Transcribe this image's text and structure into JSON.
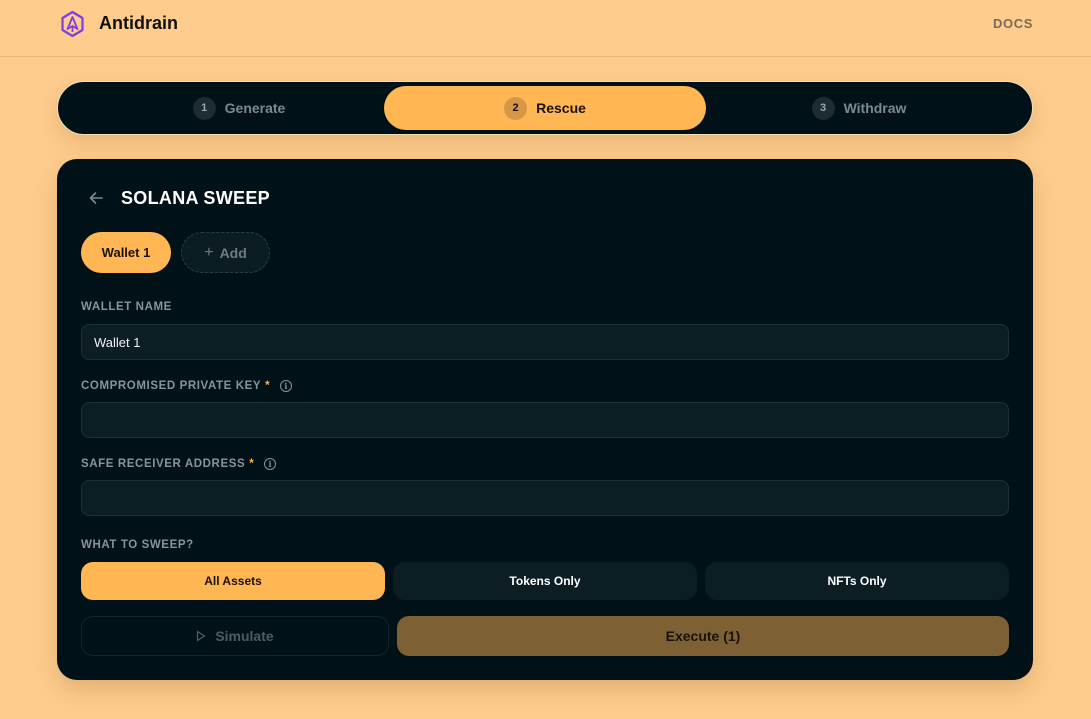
{
  "header": {
    "logo_icon": "antidrain-logo-icon",
    "brand": "Antidrain",
    "docs_link": "DOCS"
  },
  "stepper": {
    "steps": [
      {
        "number": "1",
        "label": "Generate",
        "active": false
      },
      {
        "number": "2",
        "label": "Rescue",
        "active": true
      },
      {
        "number": "3",
        "label": "Withdraw",
        "active": false
      }
    ]
  },
  "panel": {
    "back_icon": "arrow-left-icon",
    "title": "SOLANA SWEEP",
    "wallet_tabs": [
      {
        "label": "Wallet 1",
        "active": true
      }
    ],
    "add_button": {
      "icon": "+",
      "label": "Add"
    },
    "fields": {
      "wallet_name": {
        "label": "WALLET NAME",
        "value": "Wallet 1",
        "placeholder": ""
      },
      "private_key": {
        "label": "COMPROMISED PRIVATE KEY",
        "required": "*",
        "info_icon": "i",
        "value": "",
        "placeholder": ""
      },
      "receiver": {
        "label": "SAFE RECEIVER ADDRESS",
        "required": "*",
        "info_icon": "i",
        "value": "",
        "placeholder": ""
      }
    },
    "sweep": {
      "label": "WHAT TO SWEEP?",
      "options": [
        {
          "label": "All Assets",
          "selected": true
        },
        {
          "label": "Tokens Only",
          "selected": false
        },
        {
          "label": "NFTs Only",
          "selected": false
        }
      ]
    },
    "actions": {
      "simulate": "Simulate",
      "execute": "Execute (1)"
    }
  },
  "colors": {
    "page_bg": "#fecd8e",
    "panel_bg": "#001217",
    "accent": "#ffb653",
    "execute_bg": "#7e6035",
    "logo": "#7b3fe4"
  }
}
